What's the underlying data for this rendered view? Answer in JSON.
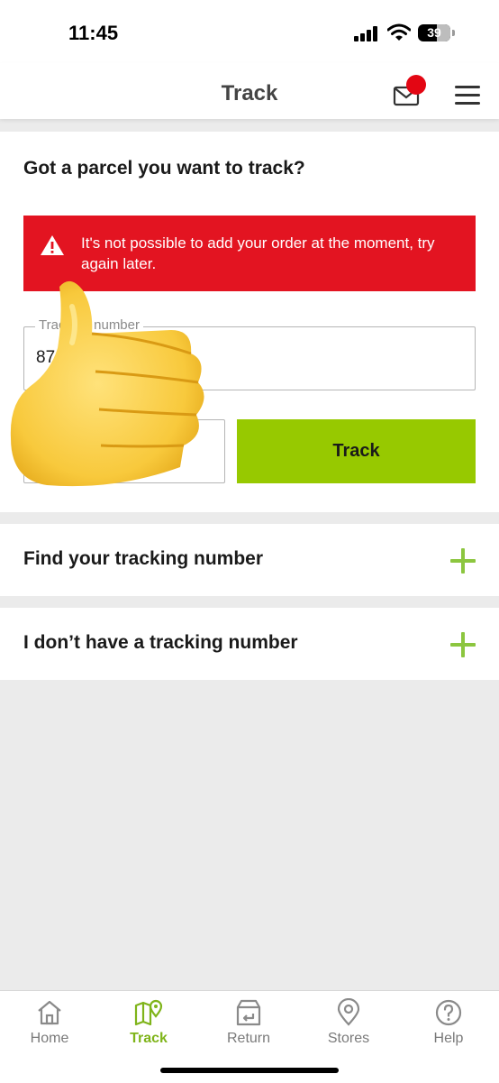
{
  "status_bar": {
    "time": "11:45",
    "battery_level": "39"
  },
  "header": {
    "title": "Track",
    "icons": [
      "mail-icon",
      "menu-icon"
    ]
  },
  "card": {
    "title": "Got a parcel you want to track?",
    "error_message": "It's not possible to add your order at the moment, try again later.",
    "tracking_field": {
      "label": "Tracking number",
      "value": "87"
    },
    "track_button_label": "Track"
  },
  "accordions": [
    {
      "label": "Find your tracking number"
    },
    {
      "label": "I don’t have a tracking number"
    }
  ],
  "tabbar": {
    "items": [
      {
        "label": "Home",
        "icon": "home-icon"
      },
      {
        "label": "Track",
        "icon": "map-icon",
        "active": true
      },
      {
        "label": "Return",
        "icon": "return-box-icon"
      },
      {
        "label": "Stores",
        "icon": "location-pin-icon"
      },
      {
        "label": "Help",
        "icon": "help-icon"
      }
    ]
  },
  "colors": {
    "accent": "#97c900",
    "error": "#e31421",
    "notification": "#e30613",
    "background": "#ebebeb"
  },
  "overlay": "thumbs-up emoji"
}
